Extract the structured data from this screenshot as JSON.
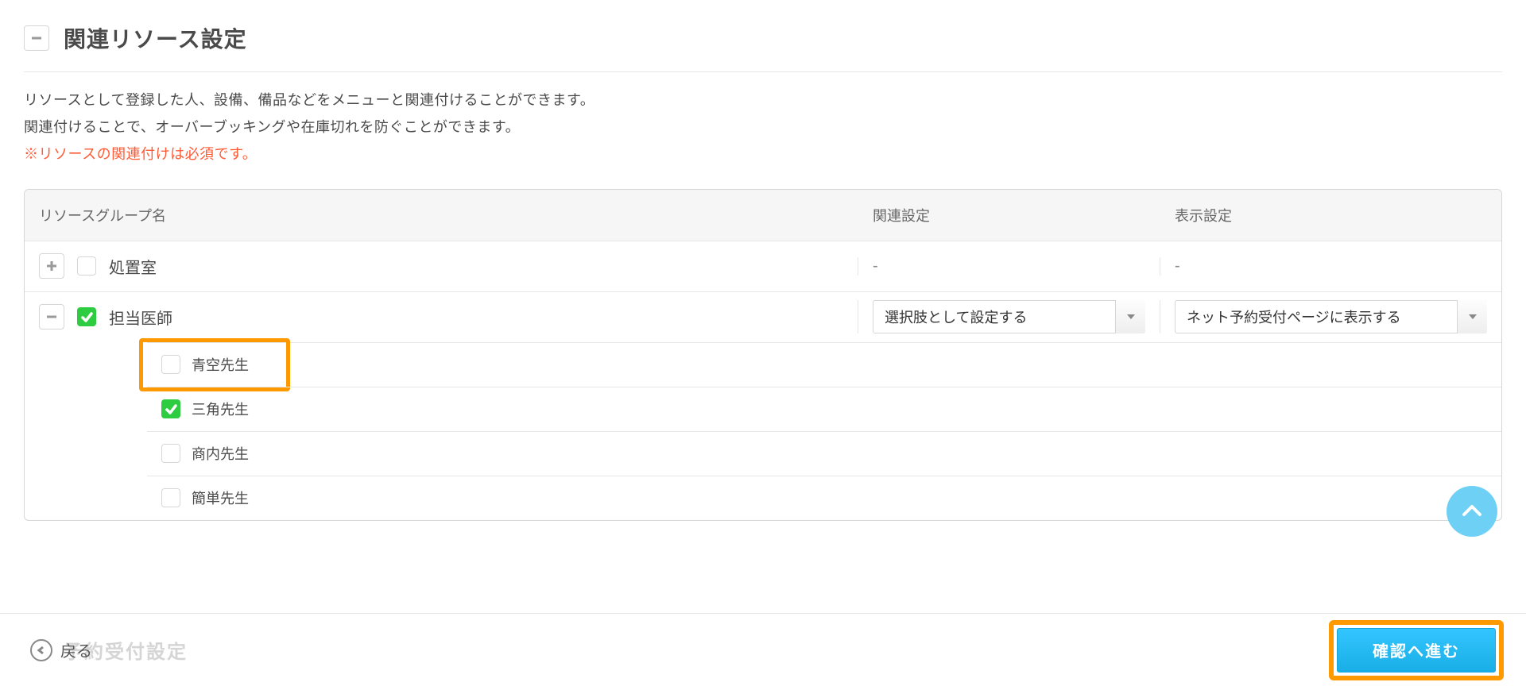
{
  "section": {
    "title": "関連リソース設定",
    "desc_line1": "リソースとして登録した人、設備、備品などをメニューと関連付けることができます。",
    "desc_line2": "関連付けることで、オーバーブッキングや在庫切れを防ぐことができます。",
    "desc_required": "※リソースの関連付けは必須です。"
  },
  "table": {
    "headers": {
      "name": "リソースグループ名",
      "related": "関連設定",
      "display": "表示設定"
    },
    "rows": {
      "room": {
        "label": "処置室",
        "related": "-",
        "display": "-"
      },
      "doctor": {
        "label": "担当医師",
        "related_select": "選択肢として設定する",
        "display_select": "ネット予約受付ページに表示する",
        "children": {
          "c0": "青空先生",
          "c1": "三角先生",
          "c2": "商内先生",
          "c3": "簡単先生"
        }
      }
    }
  },
  "footer": {
    "back": "戻る",
    "ghost": "予約受付設定",
    "primary": "確認へ進む"
  }
}
